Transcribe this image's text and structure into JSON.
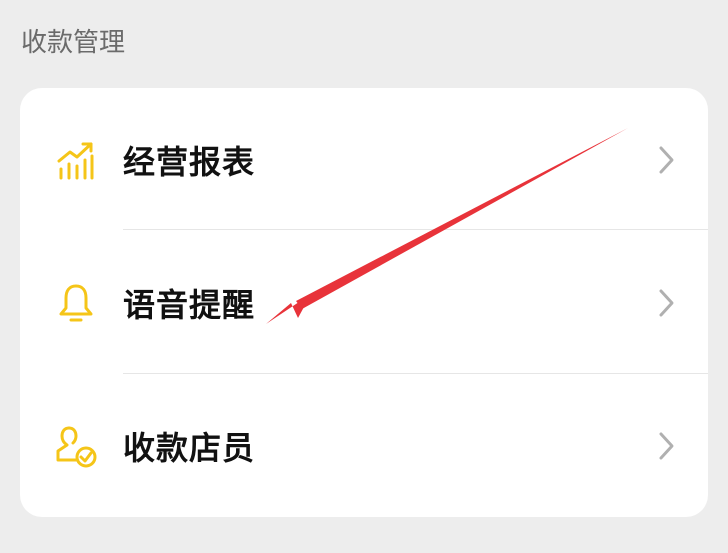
{
  "section": {
    "title": "收款管理"
  },
  "menu": {
    "items": [
      {
        "label": "经营报表",
        "icon": "chart-trend-icon"
      },
      {
        "label": "语音提醒",
        "icon": "bell-icon"
      },
      {
        "label": "收款店员",
        "icon": "user-check-icon"
      }
    ]
  },
  "colors": {
    "accent": "#f5c518",
    "annotation_arrow": "#e8333a"
  }
}
